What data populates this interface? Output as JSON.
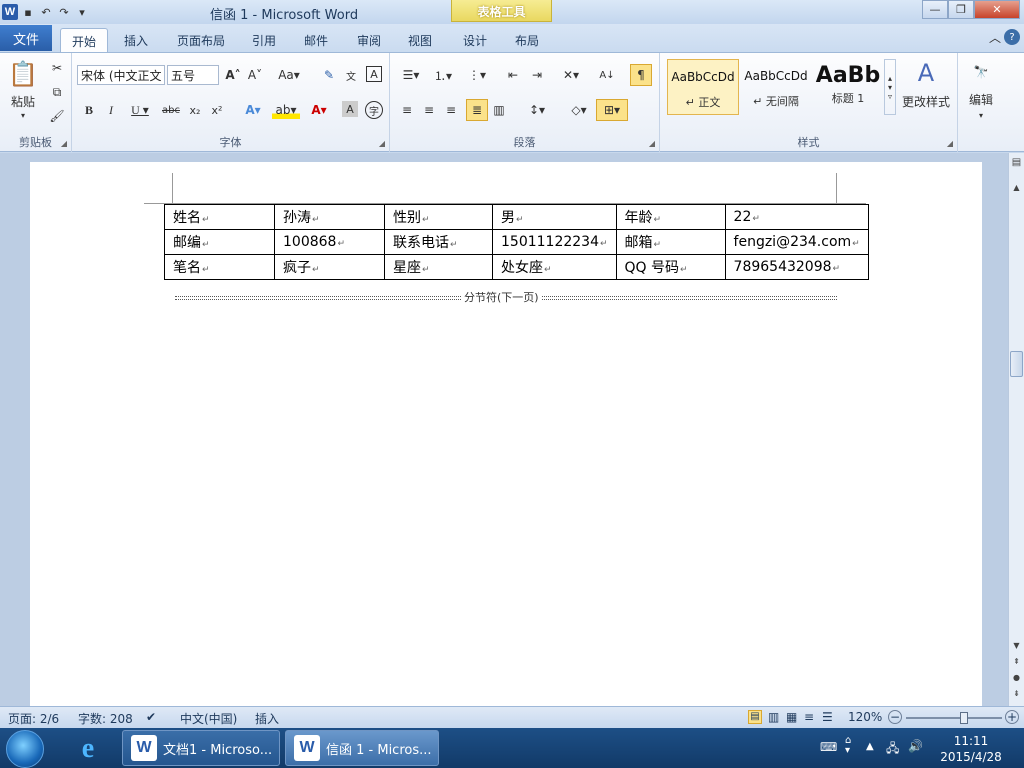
{
  "window": {
    "title": "信函 1 - Microsoft Word",
    "context_tab": "表格工具"
  },
  "ribbon_tabs": {
    "file": "文件",
    "home": "开始",
    "insert": "插入",
    "page_layout": "页面布局",
    "references": "引用",
    "mailings": "邮件",
    "review": "审阅",
    "view": "视图",
    "design": "设计",
    "layout": "布局"
  },
  "clipboard": {
    "paste": "粘贴",
    "group_label": "剪贴板"
  },
  "font": {
    "font_name": "宋体 (中文正文",
    "font_size": "五号",
    "group_label": "字体"
  },
  "paragraph": {
    "group_label": "段落"
  },
  "styles": {
    "items": [
      {
        "preview": "AaBbCcDd",
        "name": "↵ 正文"
      },
      {
        "preview": "AaBbCcDd",
        "name": "↵ 无间隔"
      },
      {
        "preview": "AaBb",
        "name": "标题 1"
      }
    ],
    "change_styles": "更改样式",
    "group_label": "样式"
  },
  "editing": {
    "label": "编辑"
  },
  "document": {
    "table": [
      [
        "姓名",
        "孙涛",
        "性别",
        "男",
        "年龄",
        "22"
      ],
      [
        "邮编",
        "100868",
        "联系电话",
        "15011122234",
        "邮箱",
        "fengzi@234.com"
      ],
      [
        "笔名",
        "疯子",
        "星座",
        "处女座",
        "QQ 号码",
        "78965432098"
      ]
    ],
    "section_break": "分节符(下一页)"
  },
  "status": {
    "page": "页面: 2/6",
    "words": "字数: 208",
    "language": "中文(中国)",
    "insert_mode": "插入",
    "zoom": "120%",
    "zoom_level": 0.6
  },
  "taskbar": {
    "items": [
      {
        "label": "文档1 - Microso..."
      },
      {
        "label": "信函 1 - Micros..."
      }
    ],
    "time": "11:11",
    "date": "2015/4/28"
  },
  "colors": {
    "accent": "#2a5ea8",
    "context_tab": "#e9d860"
  }
}
